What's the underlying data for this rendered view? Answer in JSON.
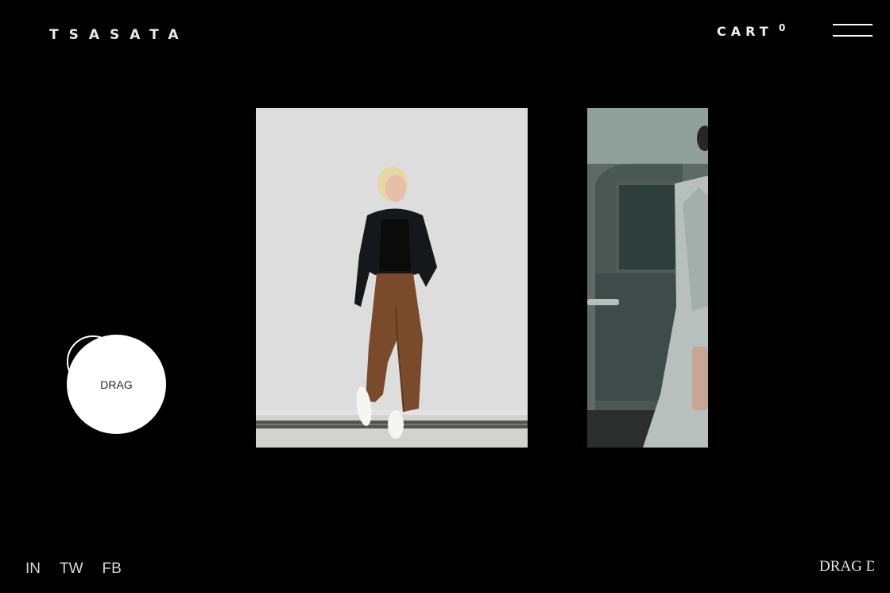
{
  "header": {
    "logo": "TSASATA",
    "cart_label": "CART",
    "cart_count": "0",
    "menu_icon": "hamburger-icon"
  },
  "slider": {
    "slides": [
      {
        "name": "model-leather-jacket-photo"
      },
      {
        "name": "model-grey-coat-photo"
      }
    ],
    "drag_label": "DRAG"
  },
  "footer": {
    "social": [
      "IN",
      "TW",
      "FB"
    ],
    "marquee_text": "DRAG DRAG DRAG"
  }
}
